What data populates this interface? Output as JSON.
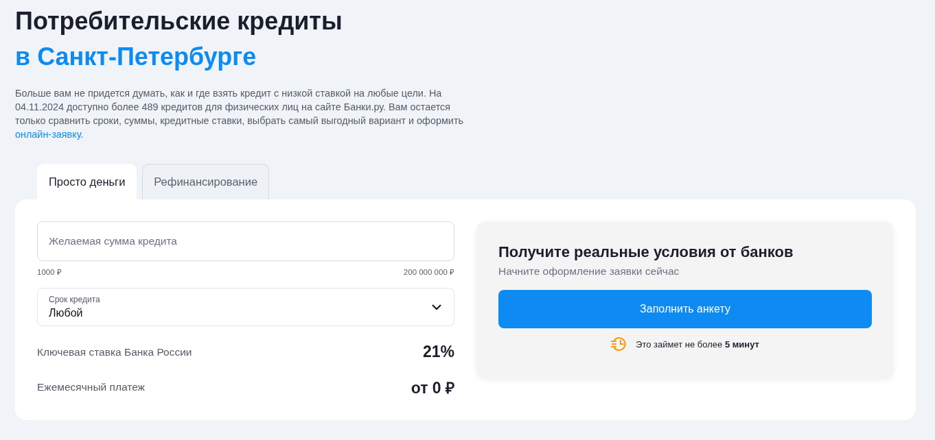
{
  "heading": {
    "line_1": "Потребительские кредиты",
    "line_2": "в Санкт-Петербурге"
  },
  "description": {
    "text": "Больше вам не придется думать, как и где взять кредит с низкой ставкой на любые цели. На 04.11.2024 доступно более 489 кредитов для физических лиц на сайте Банки.ру. Вам остается только сравнить сроки, суммы, кредитные ставки, выбрать самый выгодный вариант и оформить",
    "link": "онлайн-заявку",
    "tail": "."
  },
  "tabs": [
    {
      "label": "Просто деньги",
      "selected": true
    },
    {
      "label": "Рефинансирование",
      "selected": false
    }
  ],
  "amount_field": {
    "placeholder": "Желаемая сумма кредита",
    "min": "1000 ₽",
    "max": "200 000 000 ₽"
  },
  "term_select": {
    "label": "Срок кредита",
    "value": "Любой"
  },
  "stats": [
    {
      "label": "Ключевая ставка Банка России",
      "value": "21%"
    },
    {
      "label": "Ежемесячный платеж",
      "value": "от 0 ₽"
    }
  ],
  "offer": {
    "title": "Получите реальные условия от банков",
    "subtitle": "Начните оформление заявки сейчас",
    "button": "Заполнить анкету",
    "note": "Это займет не более **5 минут**"
  }
}
